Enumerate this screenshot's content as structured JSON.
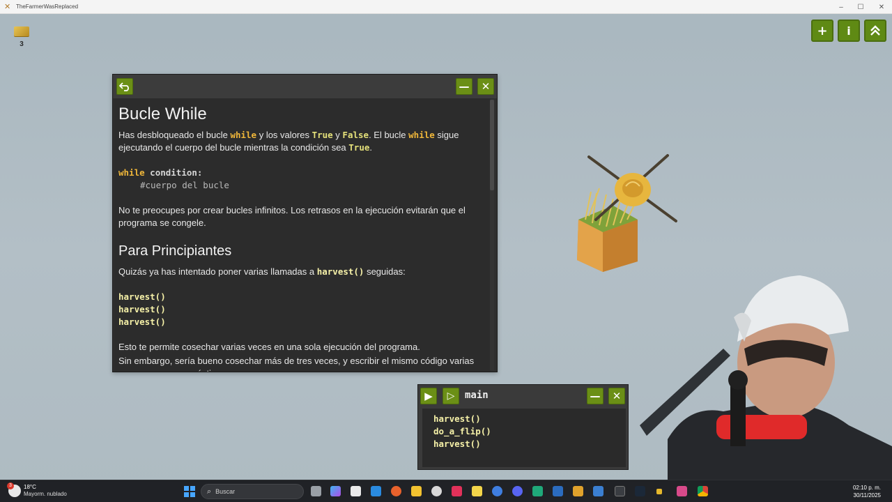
{
  "window": {
    "title": "TheFarmerWasReplaced",
    "minimize": "–",
    "maximize": "☐",
    "close": "✕"
  },
  "hud": {
    "gold_count": "3"
  },
  "top_buttons": {
    "add": "+",
    "info": "i",
    "collapse": "⌃"
  },
  "doc_window": {
    "back": "⮌",
    "minimize": "—",
    "close": "✕",
    "title": "Bucle While",
    "p1": {
      "a": "Has desbloqueado el bucle ",
      "k1": "while",
      "b": " y los valores ",
      "k2": "True",
      "c": " y ",
      "k3": "False",
      "d": ". El bucle ",
      "k4": "while",
      "e": " sigue ejecutando el cuerpo del bucle mientras la condición sea ",
      "k5": "True",
      "f": "."
    },
    "code1": {
      "kw": "while",
      "cond": " condition:",
      "comment": "#cuerpo del bucle"
    },
    "p2": "No te preocupes por crear bucles infinitos. Los retrasos en la ejecución evitarán que el programa se congele.",
    "subtitle": "Para Principiantes",
    "p3": {
      "a": "Quizás ya has intentado poner varias llamadas a ",
      "fn": "harvest()",
      "b": " seguidas:"
    },
    "code2": [
      "harvest()",
      "harvest()",
      "harvest()"
    ],
    "p4": "Esto te permite cosechar varias veces en una sola ejecución del programa.",
    "p5": "Sin embargo, sería bueno cosechar más de tres veces, y escribir el mismo código varias veces no es muy práctico."
  },
  "editor": {
    "run": "▶",
    "step": "▷",
    "name": "main",
    "minimize": "—",
    "close": "✕",
    "lines": [
      "harvest()",
      "do_a_flip()",
      "harvest()"
    ]
  },
  "taskbar": {
    "weather_temp": "18°C",
    "weather_desc": "Mayorm. nublado",
    "weather_badge": "3",
    "search_placeholder": "Buscar",
    "time": "02:10 p. m.",
    "date": "30/11/2025"
  }
}
